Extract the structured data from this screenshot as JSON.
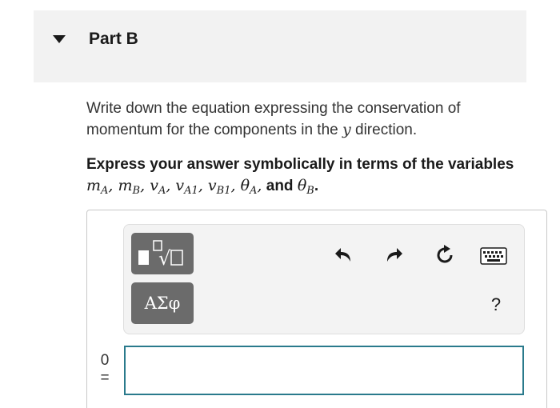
{
  "part": {
    "title": "Part B"
  },
  "instruction": {
    "line_before_var": "Write down the equation expressing the conservation of momentum for the components in the",
    "var": "y",
    "line_after_var": "direction."
  },
  "express": {
    "text": "Express your answer symbolically in terms of the variables",
    "v1": "m",
    "v1_sub": "A",
    "v2": "m",
    "v2_sub": "B",
    "v3": "v",
    "v3_sub": "A",
    "v4": "v",
    "v4_sub": "A1",
    "v5": "v",
    "v5_sub": "B1",
    "v6": "θ",
    "v6_sub": "A",
    "and": "and",
    "v7": "θ",
    "v7_sub": "B",
    "comma": ",",
    "period": "."
  },
  "toolbar": {
    "symbols_label": "ΑΣφ",
    "help_label": "?"
  },
  "equation": {
    "lhs_top": "0",
    "lhs_eq": "=",
    "input_value": ""
  }
}
